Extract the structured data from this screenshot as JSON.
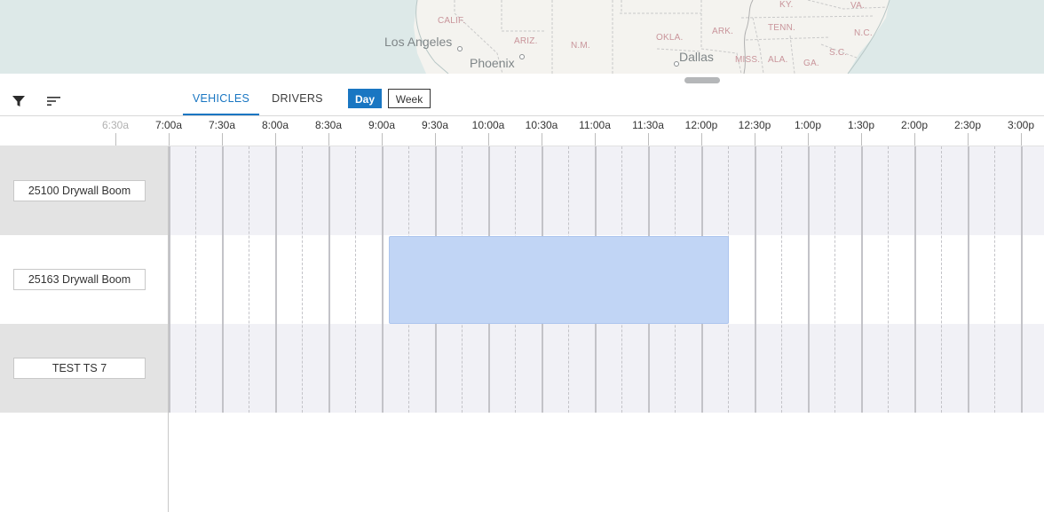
{
  "map": {
    "states": [
      "KY.",
      "VA.",
      "CALIF.",
      "TENN.",
      "N.C.",
      "ARK.",
      "OKLA.",
      "ARIZ.",
      "N.M.",
      "S.C.",
      "MISS.",
      "ALA.",
      "GA."
    ],
    "cities": [
      "Los Angeles",
      "Phoenix",
      "Dallas"
    ]
  },
  "toolbar": {
    "tabs": [
      "VEHICLES",
      "DRIVERS"
    ],
    "active_tab": "VEHICLES",
    "view_toggle": [
      "Day",
      "Week"
    ],
    "active_view": "Day"
  },
  "timeline": {
    "ticks": [
      "6:30a",
      "7:00a",
      "7:30a",
      "8:00a",
      "8:30a",
      "9:00a",
      "9:30a",
      "10:00a",
      "10:30a",
      "11:00a",
      "11:30a",
      "12:00p",
      "12:30p",
      "1:00p",
      "1:30p",
      "2:00p",
      "2:30p",
      "3:00p"
    ]
  },
  "vehicles": [
    {
      "name": "25100 Drywall Boom"
    },
    {
      "name": "25163 Drywall Boom"
    },
    {
      "name": "TEST TS 7"
    }
  ],
  "events": [
    {
      "vehicle": "25163 Drywall Boom",
      "start": "9:04a",
      "end": "12:15p",
      "color": "#c1d5f5"
    }
  ],
  "colors": {
    "accent": "#1976c2",
    "row_shade": "#f1f1f6",
    "event_fill": "#c1d5f5"
  }
}
